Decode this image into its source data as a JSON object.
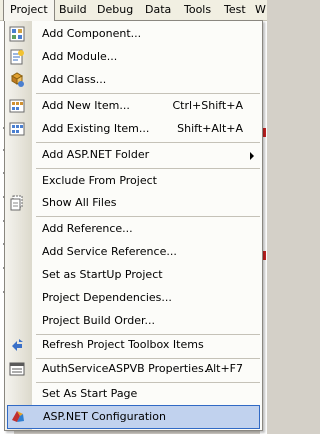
{
  "menubar": {
    "items": [
      "Project",
      "Build",
      "Debug",
      "Data",
      "Tools",
      "Test",
      "W"
    ]
  },
  "menu": {
    "items": [
      {
        "label": "Add Component...",
        "icon": "add-component-icon"
      },
      {
        "label": "Add Module...",
        "icon": "add-module-icon"
      },
      {
        "label": "Add Class...",
        "icon": "add-class-icon"
      },
      {
        "label": "Add New Item...",
        "shortcut": "Ctrl+Shift+A",
        "icon": "add-new-item-icon"
      },
      {
        "label": "Add Existing Item...",
        "shortcut": "Shift+Alt+A",
        "icon": "add-existing-item-icon"
      },
      {
        "label": "Add ASP.NET Folder",
        "submenu": true
      },
      {
        "label": "Exclude From Project"
      },
      {
        "label": "Show All Files",
        "icon": "show-all-files-icon"
      },
      {
        "label": "Add Reference..."
      },
      {
        "label": "Add Service Reference..."
      },
      {
        "label": "Set as StartUp Project"
      },
      {
        "label": "Project Dependencies..."
      },
      {
        "label": "Project Build Order..."
      },
      {
        "label": "Refresh Project Toolbox Items",
        "icon": "refresh-toolbox-icon"
      },
      {
        "label": "AuthServiceASPVB Properties...",
        "shortcut": "Alt+F7",
        "icon": "properties-icon"
      },
      {
        "label": "Set As Start Page"
      },
      {
        "label": "ASP.NET Configuration",
        "icon": "aspnet-configuration-icon",
        "highlighted": true
      }
    ]
  }
}
